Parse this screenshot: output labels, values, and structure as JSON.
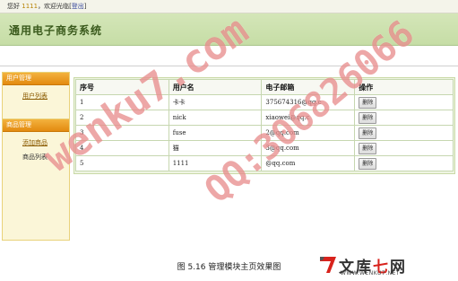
{
  "topbar": {
    "greeting": "您好",
    "username": "1111",
    "welcome": "，欢迎光临",
    "logout_open": "[",
    "logout_label": "登出",
    "logout_close": "]"
  },
  "header": {
    "title": "通用电子商务系统"
  },
  "sidebar": {
    "sections": [
      {
        "title": "用户管理",
        "items": [
          {
            "label": "用户列表"
          }
        ]
      },
      {
        "title": "商品管理",
        "items": [
          {
            "label": "添加商品"
          },
          {
            "label": "商品列表"
          }
        ]
      }
    ]
  },
  "table": {
    "headers": [
      "序号",
      "用户名",
      "电子邮箱",
      "操作"
    ],
    "delete_label": "删除",
    "rows": [
      {
        "id": "1",
        "username": "卡卡",
        "email": "375674316@qq.c"
      },
      {
        "id": "2",
        "username": "nick",
        "email": "xiaowei@qq.c"
      },
      {
        "id": "3",
        "username": "fuse",
        "email": "2@qq.com"
      },
      {
        "id": "4",
        "username": "猫",
        "email": "3@qq.com"
      },
      {
        "id": "5",
        "username": "1111",
        "email": "@qq.com"
      }
    ]
  },
  "caption": "图 5.16 管理模块主页效果图",
  "watermarks": [
    "wenku7.com",
    "QQ:306826066"
  ],
  "logo": {
    "brand_a": "文库",
    "brand_b": "七",
    "brand_c": "网",
    "url": "WWW.WENKU7.NET"
  },
  "colors": {
    "header_bg": "#c6dda6",
    "panel_head": "#e38a10",
    "watermark": "#d73c3c",
    "logo_red": "#d8221c"
  }
}
